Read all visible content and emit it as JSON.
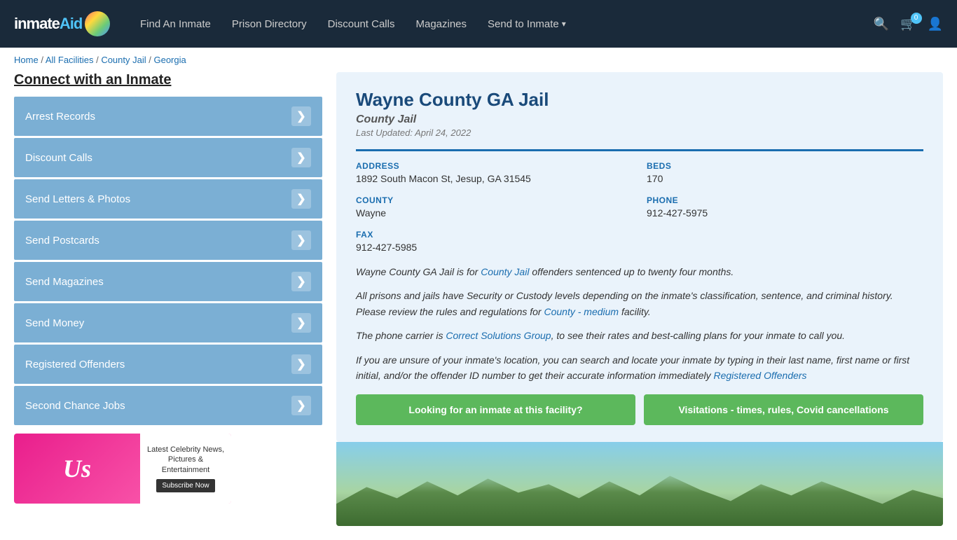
{
  "header": {
    "logo": "inmateAid",
    "nav": [
      {
        "label": "Find An Inmate",
        "id": "find-inmate"
      },
      {
        "label": "Prison Directory",
        "id": "prison-directory"
      },
      {
        "label": "Discount Calls",
        "id": "discount-calls"
      },
      {
        "label": "Magazines",
        "id": "magazines"
      },
      {
        "label": "Send to Inmate",
        "id": "send-to-inmate",
        "dropdown": true
      }
    ],
    "cart_count": "0"
  },
  "breadcrumb": {
    "items": [
      {
        "label": "Home",
        "href": "#"
      },
      {
        "label": "All Facilities",
        "href": "#"
      },
      {
        "label": "County Jail",
        "href": "#"
      },
      {
        "label": "Georgia",
        "href": "#"
      }
    ]
  },
  "sidebar": {
    "title": "Connect with an Inmate",
    "items": [
      {
        "label": "Arrest Records",
        "id": "arrest-records"
      },
      {
        "label": "Discount Calls",
        "id": "discount-calls"
      },
      {
        "label": "Send Letters & Photos",
        "id": "send-letters"
      },
      {
        "label": "Send Postcards",
        "id": "send-postcards"
      },
      {
        "label": "Send Magazines",
        "id": "send-magazines"
      },
      {
        "label": "Send Money",
        "id": "send-money"
      },
      {
        "label": "Registered Offenders",
        "id": "registered-offenders"
      },
      {
        "label": "Second Chance Jobs",
        "id": "second-chance-jobs"
      }
    ],
    "ad": {
      "logo": "Us",
      "text": "Latest Celebrity News, Pictures & Entertainment",
      "button": "Subscribe Now"
    }
  },
  "facility": {
    "title": "Wayne County GA Jail",
    "type": "County Jail",
    "last_updated": "Last Updated: April 24, 2022",
    "address_label": "ADDRESS",
    "address_value": "1892 South Macon St, Jesup, GA 31545",
    "beds_label": "BEDS",
    "beds_value": "170",
    "county_label": "COUNTY",
    "county_value": "Wayne",
    "phone_label": "PHONE",
    "phone_value": "912-427-5975",
    "fax_label": "FAX",
    "fax_value": "912-427-5985",
    "desc1": "Wayne County GA Jail is for County Jail offenders sentenced up to twenty four months.",
    "desc1_link_text": "County Jail",
    "desc2": "All prisons and jails have Security or Custody levels depending on the inmate's classification, sentence, and criminal history. Please review the rules and regulations for County - medium facility.",
    "desc2_link_text": "County - medium",
    "desc3": "The phone carrier is Correct Solutions Group, to see their rates and best-calling plans for your inmate to call you.",
    "desc3_link_text": "Correct Solutions Group",
    "desc4": "If you are unsure of your inmate's location, you can search and locate your inmate by typing in their last name, first name or first initial, and/or the offender ID number to get their accurate information immediately Registered Offenders",
    "desc4_link_text": "Registered Offenders",
    "btn1": "Looking for an inmate at this facility?",
    "btn2": "Visitations - times, rules, Covid cancellations"
  }
}
